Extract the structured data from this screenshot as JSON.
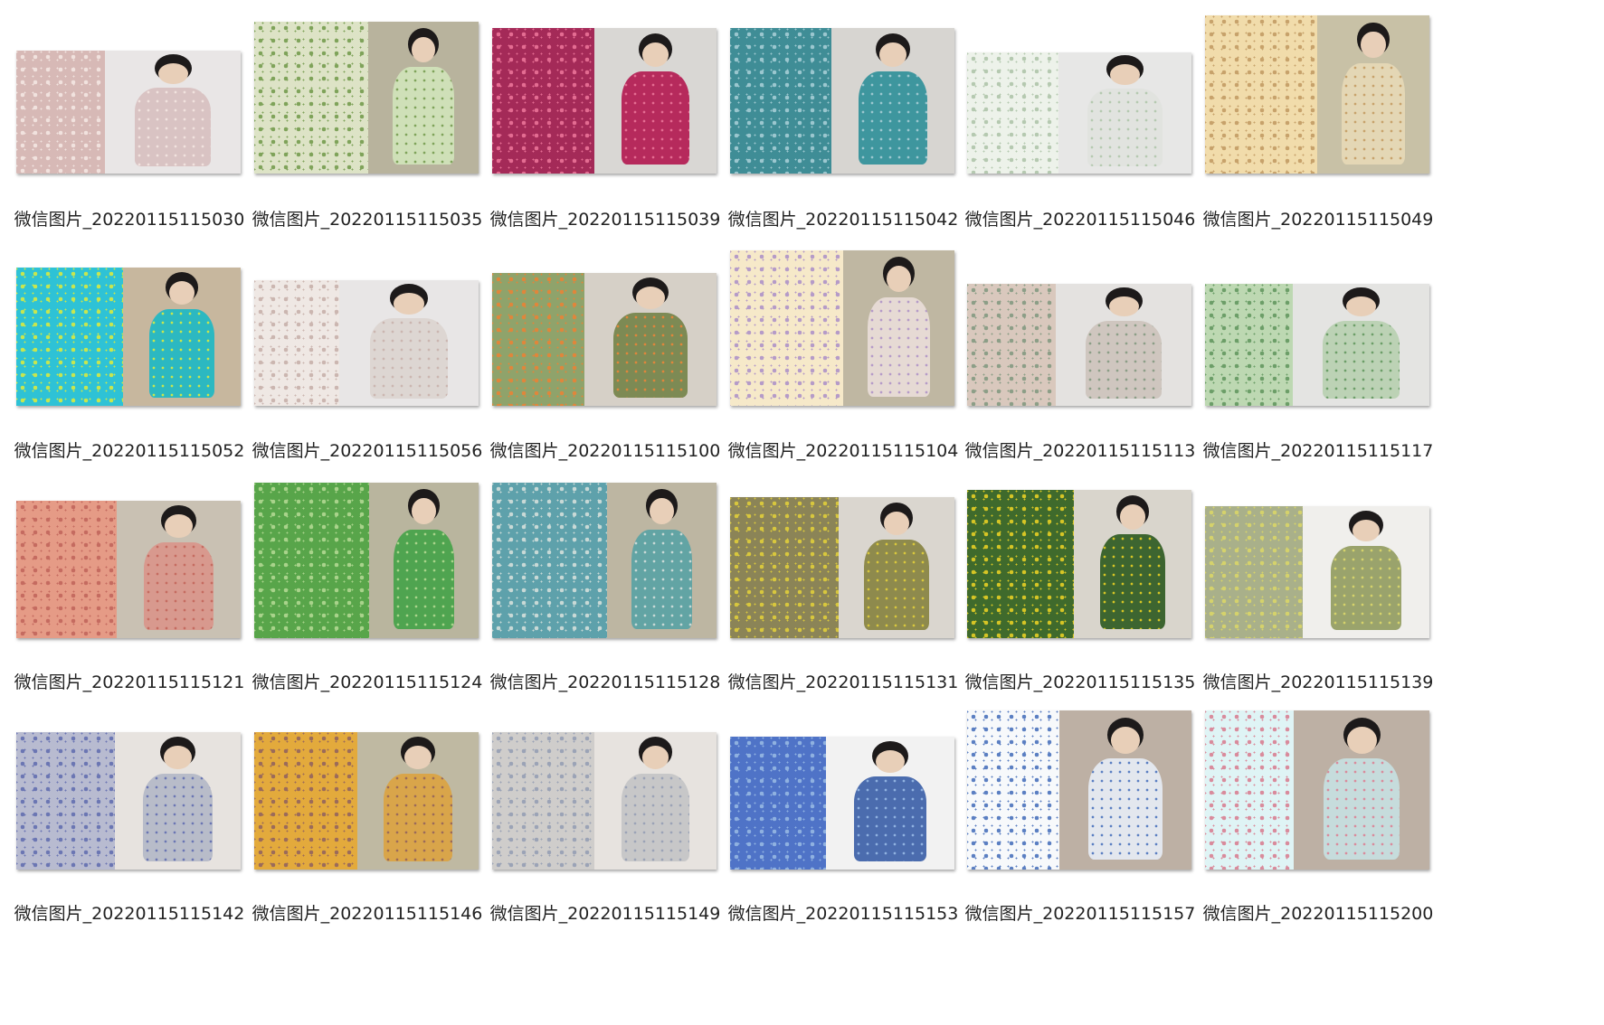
{
  "items": [
    {
      "label": "微信图片_20220115115030",
      "swatch": "#d7b9b6",
      "pattern": "#f1e2de",
      "photo_bg": "#e9e6e6",
      "garment": "#d9c3c3"
    },
    {
      "label": "微信图片_20220115115035",
      "swatch": "#dde3c6",
      "pattern": "#7fa35a",
      "photo_bg": "#b8b39d",
      "garment": "#cfe0b8"
    },
    {
      "label": "微信图片_20220115115039",
      "swatch": "#a42a58",
      "pattern": "#e46c92",
      "photo_bg": "#d9d7d4",
      "garment": "#b62a5c"
    },
    {
      "label": "微信图片_20220115115042",
      "swatch": "#3f8d96",
      "pattern": "#9bc7cf",
      "photo_bg": "#d7d5d1",
      "garment": "#3e969e"
    },
    {
      "label": "微信图片_20220115115046",
      "swatch": "#edf2ea",
      "pattern": "#b5c9b0",
      "photo_bg": "#e7e7e6",
      "garment": "#e1e3df"
    },
    {
      "label": "微信图片_20220115115049",
      "swatch": "#f1dcab",
      "pattern": "#c7a26b",
      "photo_bg": "#c8c1a6",
      "garment": "#e4d7b5"
    },
    {
      "label": "微信图片_20220115115052",
      "swatch": "#2ec2d6",
      "pattern": "#c7e64f",
      "photo_bg": "#c7b79e",
      "garment": "#2cb8c1"
    },
    {
      "label": "微信图片_20220115115056",
      "swatch": "#efe8e4",
      "pattern": "#cbb6b0",
      "photo_bg": "#e8e6e6",
      "garment": "#ddd6d2"
    },
    {
      "label": "微信图片_20220115115100",
      "swatch": "#8fa36b",
      "pattern": "#e0863b",
      "photo_bg": "#d6d0c7",
      "garment": "#7d8a54"
    },
    {
      "label": "微信图片_20220115115104",
      "swatch": "#f6e9c9",
      "pattern": "#b59bc8",
      "photo_bg": "#bfb7a2",
      "garment": "#e6dad4"
    },
    {
      "label": "微信图片_20220115115113",
      "swatch": "#d9c8bd",
      "pattern": "#8c9e87",
      "photo_bg": "#e4e2e0",
      "garment": "#cfc6bf"
    },
    {
      "label": "微信图片_20220115115117",
      "swatch": "#bdd8b2",
      "pattern": "#6c9e68",
      "photo_bg": "#e4e4e2",
      "garment": "#bcd2b5"
    },
    {
      "label": "微信图片_20220115115121",
      "swatch": "#e59b86",
      "pattern": "#c56b60",
      "photo_bg": "#c9c1b3",
      "garment": "#d8998e"
    },
    {
      "label": "微信图片_20220115115124",
      "swatch": "#58a54a",
      "pattern": "#a9d38b",
      "photo_bg": "#b9b59e",
      "garment": "#4fa450"
    },
    {
      "label": "微信图片_20220115115128",
      "swatch": "#5ea1ab",
      "pattern": "#c8d9d6",
      "photo_bg": "#bdb6a2",
      "garment": "#62a4a4"
    },
    {
      "label": "微信图片_20220115115131",
      "swatch": "#8b8457",
      "pattern": "#d8c73d",
      "photo_bg": "#dad6cf",
      "garment": "#8e8a4d"
    },
    {
      "label": "微信图片_20220115115135",
      "swatch": "#3f6a2c",
      "pattern": "#d6c525",
      "photo_bg": "#d9d5cc",
      "garment": "#3d6530"
    },
    {
      "label": "微信图片_20220115115139",
      "swatch": "#a9b08a",
      "pattern": "#d5d26b",
      "photo_bg": "#f0efec",
      "garment": "#9aa36c"
    },
    {
      "label": "微信图片_20220115115142",
      "swatch": "#b8bbd0",
      "pattern": "#6b76b3",
      "photo_bg": "#e7e3df",
      "garment": "#b8bcc9"
    },
    {
      "label": "微信图片_20220115115146",
      "swatch": "#e3aa3c",
      "pattern": "#9b6b5a",
      "photo_bg": "#bfb9a2",
      "garment": "#d9a54a"
    },
    {
      "label": "微信图片_20220115115149",
      "swatch": "#cfcdcb",
      "pattern": "#9ba3b6",
      "photo_bg": "#e7e3df",
      "garment": "#c7c7c8"
    },
    {
      "label": "微信图片_20220115115153",
      "swatch": "#4f73c7",
      "pattern": "#8fb1e0",
      "photo_bg": "#f2f2f2",
      "garment": "#4b6cae"
    },
    {
      "label": "微信图片_20220115115157",
      "swatch": "#f7f9fb",
      "pattern": "#5b7fc2",
      "photo_bg": "#bdb0a4",
      "garment": "#e3e7ee"
    },
    {
      "label": "微信图片_20220115115200",
      "swatch": "#dff4f5",
      "pattern": "#d98b9c",
      "photo_bg": "#bdb0a4",
      "garment": "#c6dcdc"
    }
  ]
}
